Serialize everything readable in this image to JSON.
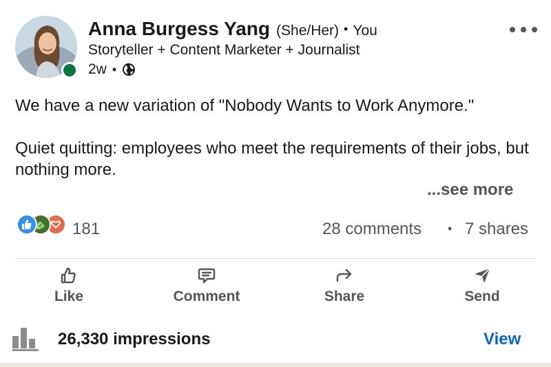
{
  "post": {
    "author": {
      "name": "Anna Burgess Yang",
      "pronouns": "(She/Her)",
      "separator": "•",
      "relationship": "You",
      "headline": "Storyteller + Content Marketer + Journalist",
      "time_ago": "2w",
      "visibility_icon": "globe-icon",
      "online_status_color": "#057642"
    },
    "more_menu_icon": "more-horizontal-icon",
    "text": {
      "paragraph_1": "We have a new variation of \"Nobody Wants to Work Anymore.\"",
      "paragraph_2": "Quiet quitting: employees who meet the requirements of their jobs, but nothing more.",
      "see_more": "...see more"
    },
    "social_counts": {
      "reaction_icons": [
        "like-reaction-icon",
        "celebrate-reaction-icon",
        "love-reaction-icon"
      ],
      "reactions": "181",
      "comments": "28 comments",
      "separator": "•",
      "shares": "7 shares"
    },
    "actions": [
      {
        "label": "Like",
        "icon": "thumbs-up-icon"
      },
      {
        "label": "Comment",
        "icon": "comment-icon"
      },
      {
        "label": "Share",
        "icon": "share-arrow-icon"
      },
      {
        "label": "Send",
        "icon": "send-icon"
      }
    ],
    "impressions": {
      "icon": "bar-chart-icon",
      "text": "26,330 impressions",
      "view_label": "View"
    },
    "colors": {
      "link_blue": "#0a66c2",
      "text_primary": "#191919",
      "text_secondary": "#555555"
    }
  }
}
